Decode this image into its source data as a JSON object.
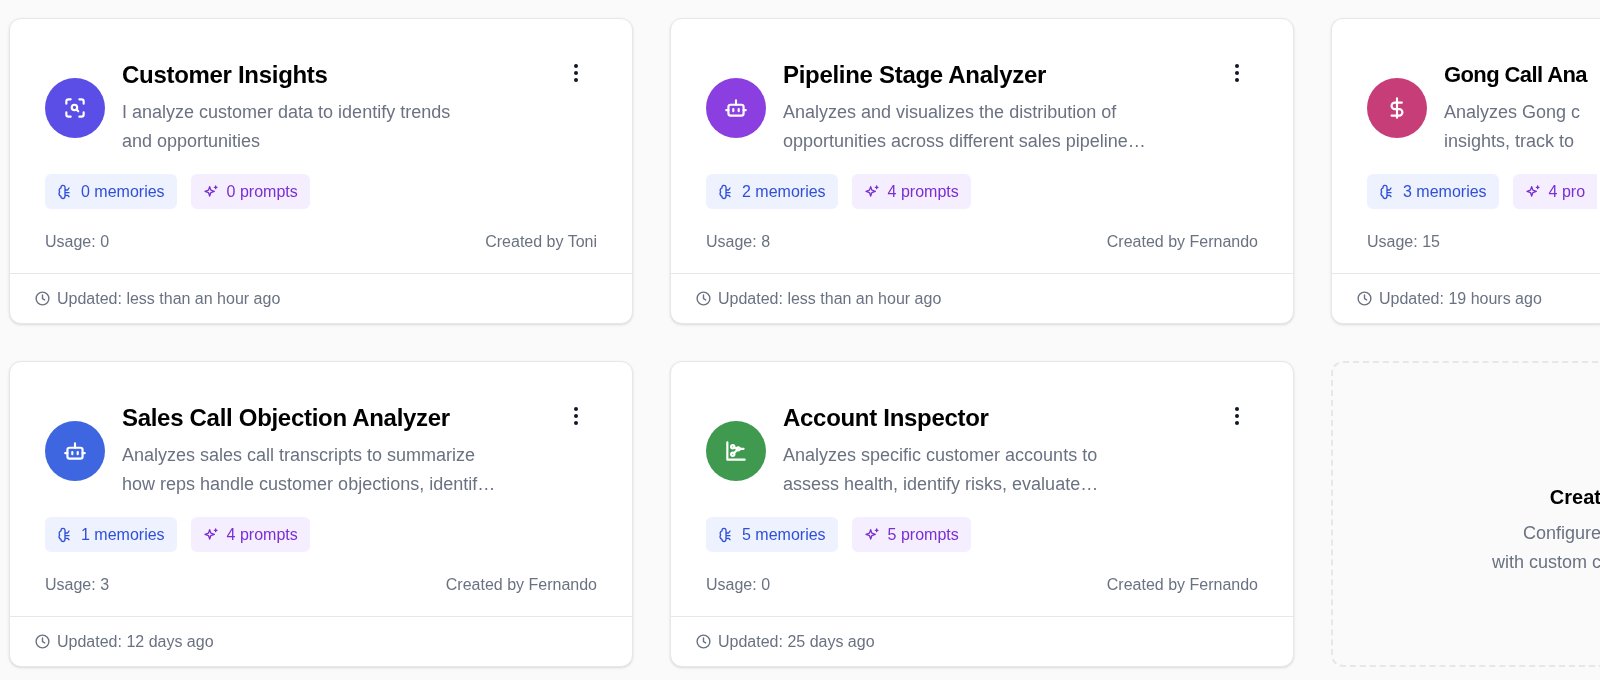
{
  "agents": [
    {
      "title": "Customer Insights",
      "color": "#5b4ee6",
      "description_lines": [
        "I analyze customer data to identify trends",
        "and opportunities"
      ],
      "memories": "0 memories",
      "prompts": "0 prompts",
      "usage": "Usage: 0",
      "creator": "Created by Toni",
      "updated": "Updated: less than an hour ago"
    },
    {
      "title": "Pipeline Stage Analyzer",
      "color": "#8b3fe0",
      "description_lines": [
        "Analyzes and visualizes the distribution of",
        "opportunities across different sales pipeline…"
      ],
      "memories": "2 memories",
      "prompts": "4 prompts",
      "usage": "Usage: 8",
      "creator": "Created by Fernando",
      "updated": "Updated: less than an hour ago"
    },
    {
      "title": "Gong Call Ana",
      "color": "#c73d78",
      "description_lines": [
        "Analyzes Gong c",
        "insights, track to"
      ],
      "memories": "3 memories",
      "prompts": "4 pro",
      "usage": "Usage: 15",
      "updated": "Updated: 19 hours ago"
    },
    {
      "title": "Sales Call Objection Analyzer",
      "color": "#3e66e0",
      "description_lines": [
        "Analyzes sales call transcripts to summarize",
        "how reps handle customer objections, identif…"
      ],
      "memories": "1 memories",
      "prompts": "4 prompts",
      "usage": "Usage: 3",
      "creator": "Created by Fernando",
      "updated": "Updated: 12 days ago"
    },
    {
      "title": "Account Inspector",
      "color": "#3f9a4f",
      "description_lines": [
        "Analyzes specific customer accounts to",
        "assess health, identify risks, evaluate…"
      ],
      "memories": "5 memories",
      "prompts": "5 prompts",
      "usage": "Usage: 0",
      "creator": "Created by Fernando",
      "updated": "Updated: 25 days ago"
    }
  ],
  "create_card": {
    "title": "Creat",
    "lines": [
      "Configure",
      "with custom c"
    ]
  }
}
